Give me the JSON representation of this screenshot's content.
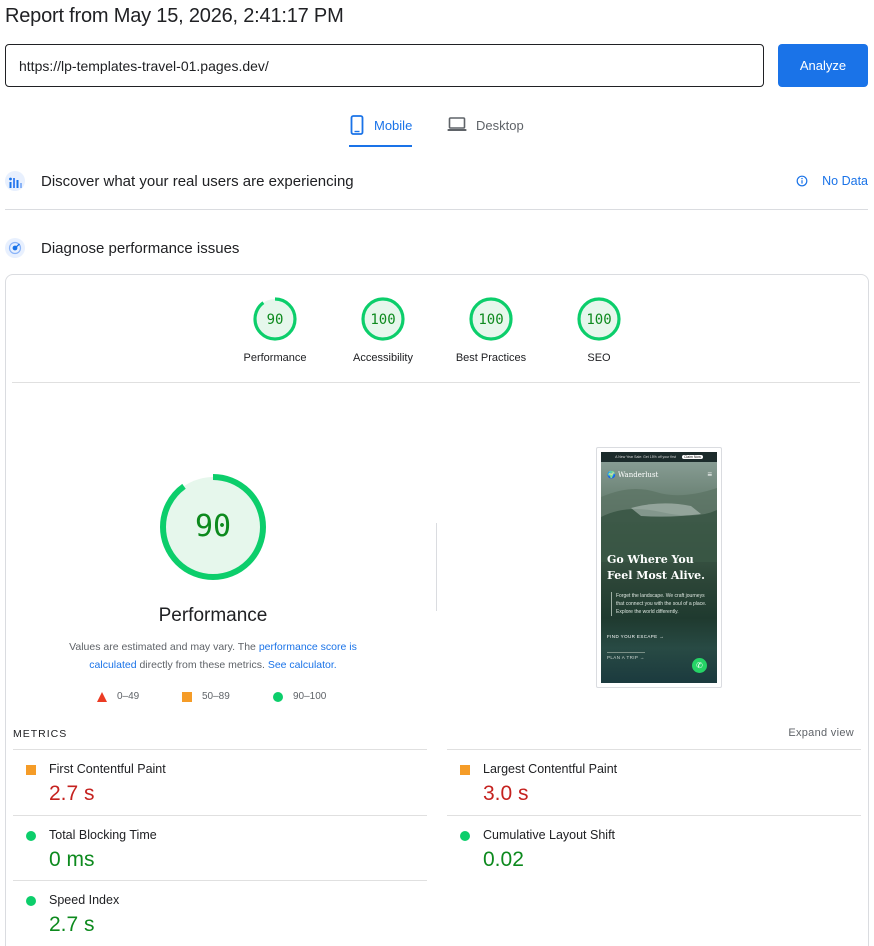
{
  "report": {
    "title": "Report from May 15, 2026, 2:41:17 PM"
  },
  "url_bar": {
    "value": "https://lp-templates-travel-01.pages.dev/",
    "analyze_label": "Analyze"
  },
  "tabs": [
    {
      "label": "Mobile",
      "icon": "smartphone-icon",
      "selected": true
    },
    {
      "label": "Desktop",
      "icon": "laptop-icon",
      "selected": false
    }
  ],
  "field_data": {
    "title": "Discover what your real users are experiencing",
    "status": "No Data",
    "icon": "crux-users-icon"
  },
  "diagnose": {
    "title": "Diagnose performance issues",
    "icon": "lighthouse-icon"
  },
  "scores": [
    {
      "label": "Performance",
      "value": "90"
    },
    {
      "label": "Accessibility",
      "value": "100"
    },
    {
      "label": "Best Practices",
      "value": "100"
    },
    {
      "label": "SEO",
      "value": "100"
    }
  ],
  "performance_detail": {
    "score": "90",
    "title": "Performance",
    "desc_1": "Values are estimated and may vary. The ",
    "desc_link_1": "performance score is calculated",
    "desc_2": " directly from these metrics. ",
    "desc_link_2": "See calculator."
  },
  "legend": [
    {
      "shape": "triangle",
      "color": "#eb3b23",
      "range": "0–49"
    },
    {
      "shape": "square",
      "color": "#f59c28",
      "range": "50–89"
    },
    {
      "shape": "circle",
      "color": "#0cce6b",
      "range": "90–100"
    }
  ],
  "screenshot": {
    "topbar": "A New Year Sale: Get 15% off your first",
    "topbar_button": "Claim Now",
    "logo": "Wanderlust",
    "headline": "Go Where You Feel Most Alive.",
    "body": "Forget the landscape. We craft journeys that connect you with the soul of a place. Explore the world differently.",
    "cta": "FIND YOUR ESCAPE  →",
    "cta2": "PLAN A TRIP  →"
  },
  "metrics_header": {
    "label": "METRICS",
    "expand": "Expand view"
  },
  "metrics": [
    {
      "name": "First Contentful Paint",
      "value": "2.7 s",
      "rating": "average"
    },
    {
      "name": "Largest Contentful Paint",
      "value": "3.0 s",
      "rating": "average"
    },
    {
      "name": "Total Blocking Time",
      "value": "0 ms",
      "rating": "good"
    },
    {
      "name": "Cumulative Layout Shift",
      "value": "0.02",
      "rating": "good"
    },
    {
      "name": "Speed Index",
      "value": "2.7 s",
      "rating": "good"
    }
  ],
  "colors": {
    "accent": "#1a73e8",
    "pass": "#0cce6b",
    "pass_text": "#0d8a1e",
    "average": "#f59c28",
    "average_text": "#c5221f",
    "fail": "#eb3b23"
  }
}
